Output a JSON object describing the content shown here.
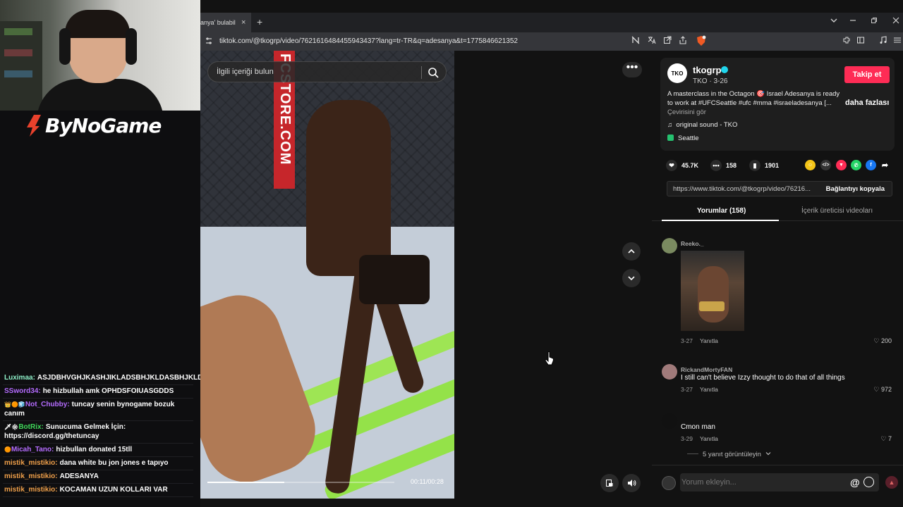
{
  "stream": {
    "logo_text": "ByNoGame",
    "chat": [
      {
        "user": "Luximaa:",
        "user_color": "#8ef0c8",
        "text": "ASJDBHVGHJKASHJIKLADSBHJKLDASBHJKLDAS"
      },
      {
        "user": "SSword34:",
        "user_color": "#b56cff",
        "text": "he hizbullah amk OPHDSFOIUASGDDS"
      },
      {
        "user": "Not_Chubby:",
        "user_color": "#b56cff",
        "badges": "👑🟠🧊",
        "text": "tuncay senin bynogame bozuk canım"
      },
      {
        "user": "BotRix:",
        "user_color": "#3fd85a",
        "badges": "🗡❇",
        "text": "Sunucuma Gelmek İçin: https://discord.gg/thetuncay"
      },
      {
        "user": "Micah_Tano:",
        "user_color": "#b56cff",
        "badges": "🟠",
        "text": "hizbullan donated 15tll"
      },
      {
        "user": "mistik_mistikio:",
        "user_color": "#f0a04a",
        "text": "dana white bu jon jones e tapıyo"
      },
      {
        "user": "mistik_mistikio:",
        "user_color": "#f0a04a",
        "text": "ADESANYA"
      },
      {
        "user": "mistik_mistikio:",
        "user_color": "#f0a04a",
        "text": "KOCAMAN UZUN KOLLARI VAR"
      }
    ]
  },
  "browser": {
    "tab_title": "anya' bulabilirsiniz",
    "tab_close": "×",
    "new_tab": "+",
    "url": "tiktok.com/@tkogrp/video/7621616484455943437?lang=tr-TR&q=adesanya&t=1775846621352"
  },
  "video": {
    "search_placeholder": "İlgili içeriği bulun",
    "poster_text": "FCSTORE.COM",
    "current_time": "00:11/00:28",
    "progress": 0.41
  },
  "post": {
    "avatar_text": "TKO",
    "username": "tkogrp",
    "subline": "TKO · 3-26",
    "follow_label": "Takip et",
    "description": "A masterclass in the Octagon 🎯 Israel Adesanya is ready to work at #UFCSeattle #ufc #mma #israeladesanya [...",
    "more_label": "daha fazlası",
    "translate_label": "Çevirisini gör",
    "sound": "original sound - TKO",
    "location": "Seattle",
    "likes": "45.7K",
    "comments": "158",
    "saves": "1901",
    "link_url": "https://www.tiktok.com/@tkogrp/video/76216...",
    "copy_label": "Bağlantıyı kopyala",
    "tab_comments": "Yorumlar (158)",
    "tab_creator": "İçerik üreticisi videoları"
  },
  "comments": [
    {
      "user": "Reeko._",
      "text": "",
      "date": "3-27",
      "reply": "Yanıtla",
      "likes": "200",
      "avatar_color": "#7a8a60"
    },
    {
      "user": "RickandMortyFAN",
      "text": "I still can't believe Izzy thought to do that of all things",
      "date": "3-27",
      "reply": "Yanıtla",
      "likes": "972",
      "avatar_color": "#a07a7a"
    },
    {
      "user": "ﾠ",
      "text": "Cmon man",
      "date": "3-29",
      "reply": "Yanıtla",
      "likes": "7",
      "avatar_color": "#111111"
    }
  ],
  "view_replies": "5 yanıt görüntüleyin",
  "compose_placeholder": "Yorum ekleyin...",
  "colors": {
    "accent": "#fe2c55",
    "verified": "#20d5ec"
  }
}
